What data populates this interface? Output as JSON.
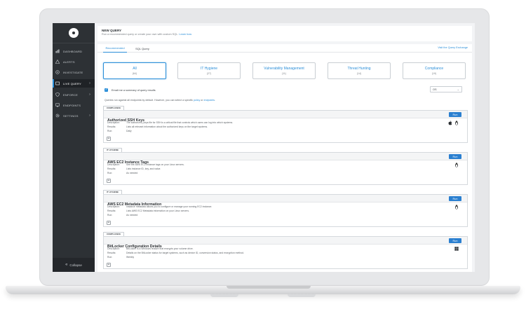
{
  "app": {
    "header_title": "NEW QUERY",
    "header_subtitle": "Run a recommended query or create your own with custom SQL.",
    "header_link": "Learn how"
  },
  "sidebar": {
    "items": [
      {
        "label": "DASHBOARD",
        "icon": "dashboard-icon"
      },
      {
        "label": "ALERTS",
        "icon": "alert-triangle-icon"
      },
      {
        "label": "INVESTIGATE",
        "icon": "investigate-icon"
      },
      {
        "label": "LIVE QUERY",
        "icon": "live-query-icon"
      },
      {
        "label": "ENFORCE",
        "icon": "shield-check-icon"
      },
      {
        "label": "ENDPOINTS",
        "icon": "endpoints-icon"
      },
      {
        "label": "SETTINGS",
        "icon": "gear-icon"
      }
    ],
    "collapse_label": "Collapse"
  },
  "tabs": {
    "recommended": "Recommended",
    "sql": "SQL Query",
    "exchange_link": "Visit the Query Exchange"
  },
  "categories": [
    {
      "name": "All",
      "count": "(64)"
    },
    {
      "name": "IT Hygiene",
      "count": "(27)"
    },
    {
      "name": "Vulnerability Management",
      "count": "(11)"
    },
    {
      "name": "Threat Hunting",
      "count": "(14)"
    },
    {
      "name": "Compliance",
      "count": "(19)"
    }
  ],
  "email_label": "Email me a summary of query results",
  "os_select_value": "OS",
  "notice": {
    "text": "Queries run against all endpoints by default. However, you can select a specific",
    "link1": "policy",
    "and": "or",
    "link2": "endpoints"
  },
  "labels": {
    "description": "Description:",
    "results": "Results:",
    "run": "Run:",
    "run_button": "Run",
    "plus": "+"
  },
  "queries": [
    {
      "tag": "COMPLIANCE",
      "title": "Authorized SSH Keys",
      "description": "The authorized_keys file for SSH is a critical file that controls which users can log into which systems.",
      "results": "Lists all relevant information about the authorized keys on the target systems.",
      "run": "Daily",
      "os_icons": [
        "apple-icon",
        "linux-icon"
      ]
    },
    {
      "tag": "IT HYGIENE",
      "title": "AWS EC2 Instance Tags",
      "description": "See the AWS EC2 instance tags on your Linux servers.",
      "results": "Lists instance ID, key, and value.",
      "run": "As needed",
      "os_icons": [
        "linux-icon"
      ]
    },
    {
      "tag": "IT HYGIENE",
      "title": "AWS EC2 Metadata Information",
      "description": "Instance metadata allows you to configure or manage your running EC2 instance.",
      "results": "Lists AWS EC2 Metadata information on your Linux servers.",
      "run": "As needed",
      "os_icons": [
        "linux-icon"
      ]
    },
    {
      "tag": "COMPLIANCE",
      "title": "BitLocker Configuration Details",
      "description": "BitLocker is a Windows feature that encrypts your volume drive.",
      "results": "Details on the BitLocker status for target systems, such as device ID, conversion status, and encryption method.",
      "run": "Weekly",
      "os_icons": [
        "windows-icon"
      ]
    }
  ]
}
